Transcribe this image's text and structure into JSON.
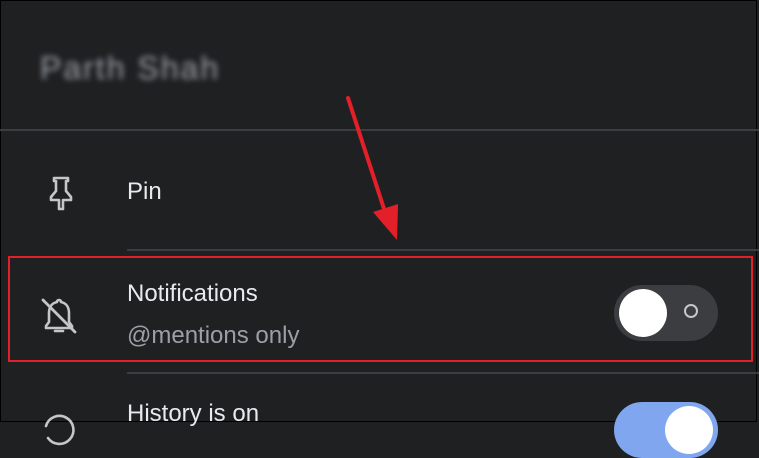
{
  "header": {
    "name": "Parth Shah"
  },
  "menu": {
    "pin": {
      "label": "Pin",
      "icon": "pin-icon"
    },
    "notifications": {
      "label": "Notifications",
      "sublabel": "@mentions only",
      "icon": "bell-off-icon",
      "enabled": false
    },
    "history": {
      "label": "History is on",
      "icon": "history-icon",
      "enabled": true
    }
  },
  "colors": {
    "background": "#1f2022",
    "highlight": "#e3202a",
    "toggle_on": "#7fa6ee"
  }
}
